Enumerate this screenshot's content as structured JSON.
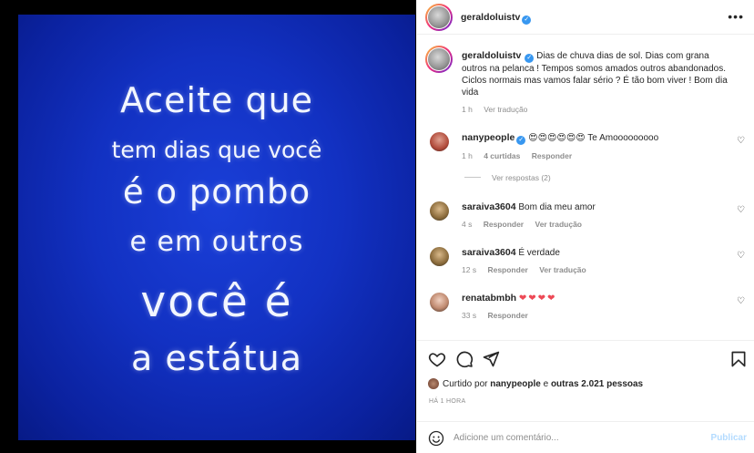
{
  "media": {
    "lines": [
      "Aceite que",
      "tem dias que você",
      "é o pombo",
      "e em outros",
      "você é",
      "a estátua"
    ]
  },
  "header": {
    "username": "geraldoluistv",
    "more_icon": "more-horizontal-icon"
  },
  "caption": {
    "username": "geraldoluistv",
    "text": "Dias de chuva dias de sol. Dias com grana outros na pelanca ! Tempos somos amados outros abandonados. Ciclos normais mas vamos falar sério ? É tão bom viver ! Bom dia vida",
    "time": "1 h",
    "translate": "Ver tradução"
  },
  "comments": [
    {
      "username": "nanypeople",
      "text": "😍😍😍😍😍😍 Te Amooooooooo",
      "time": "1 h",
      "likes": "4 curtidas",
      "reply": "Responder",
      "view_replies": "Ver respostas (2)"
    },
    {
      "username": "saraiva3604",
      "text": "Bom dia meu amor",
      "time": "4 s",
      "reply": "Responder",
      "translate": "Ver tradução"
    },
    {
      "username": "saraiva3604",
      "text": "É verdade",
      "time": "12 s",
      "reply": "Responder",
      "translate": "Ver tradução"
    },
    {
      "username": "renatabmbh",
      "text": "❤❤❤❤",
      "time": "33 s",
      "reply": "Responder"
    }
  ],
  "likes": {
    "prefix": "Curtido por",
    "user": "nanypeople",
    "middle": "e",
    "others": "outras 2.021 pessoas"
  },
  "ago": "HÁ 1 HORA",
  "add_comment": {
    "placeholder": "Adicione um comentário...",
    "publish": "Publicar"
  },
  "colors": {
    "media_blue": "#1231c2",
    "verified": "#3897f0",
    "publish_disabled": "#b3dbff",
    "heart": "#ed4956"
  }
}
